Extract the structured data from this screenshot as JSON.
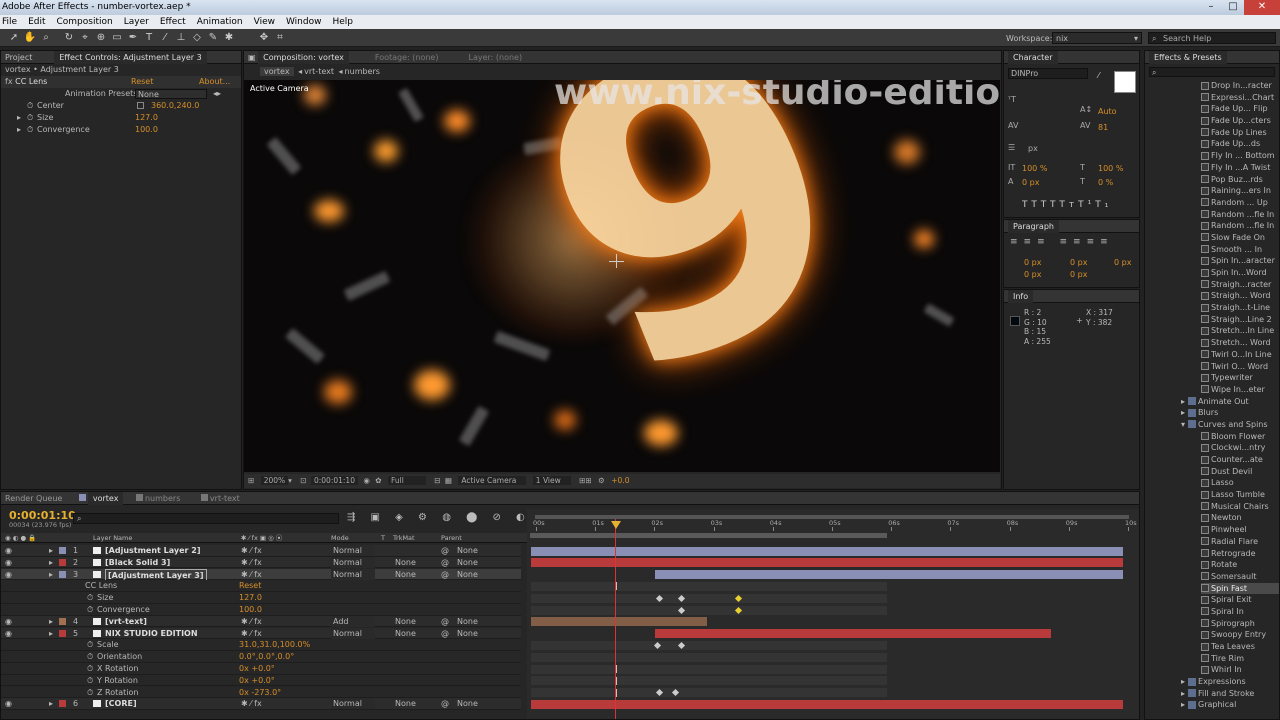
{
  "app": {
    "title": "Adobe After Effects - number-vortex.aep *"
  },
  "menu": [
    "File",
    "Edit",
    "Composition",
    "Layer",
    "Effect",
    "Animation",
    "View",
    "Window",
    "Help"
  ],
  "toolbar": {
    "workspace_label": "Workspace:",
    "workspace_value": "nix",
    "search_placeholder": "Search Help"
  },
  "effect_controls": {
    "project_tab": "Project",
    "tab": "Effect Controls: Adjustment Layer 3",
    "breadcrumb": "vortex • Adjustment Layer 3",
    "effect": "CC Lens",
    "reset": "Reset",
    "about": "About...",
    "presets_label": "Animation Presets:",
    "presets_value": "None",
    "props": [
      {
        "name": "Center",
        "value": "360.0,240.0"
      },
      {
        "name": "Size",
        "value": "127.0"
      },
      {
        "name": "Convergence",
        "value": "100.0"
      }
    ]
  },
  "composition": {
    "tab": "Composition: vortex",
    "footage_tab": "Footage: (none)",
    "layer_tab": "Layer: (none)",
    "crumbs": [
      "vortex",
      "vrt-text",
      "numbers"
    ],
    "active_camera": "Active Camera",
    "watermark": "www.nix-studio-edition.ru",
    "big_digit": "9",
    "zoom": "200%",
    "timecode": "0:00:01:10",
    "resolution": "Full",
    "camera": "Active Camera",
    "view": "1 View",
    "exposure": "+0.0"
  },
  "character": {
    "tab": "Character",
    "font": "DINPro",
    "size": "px",
    "auto": "Auto",
    "tracking": "81",
    "scale_v": "100 %",
    "scale_h": "100 %",
    "baseline": "0 px",
    "tsume": "0 %",
    "buttons": [
      "T",
      "T",
      "TT",
      "Tт",
      "T¹",
      "T₁"
    ]
  },
  "paragraph": {
    "tab": "Paragraph",
    "indents": [
      "0 px",
      "0 px",
      "0 px",
      "0 px",
      "0 px"
    ]
  },
  "info": {
    "tab": "Info",
    "r": "R : 2",
    "g": "G : 10",
    "b": "B : 15",
    "a": "A : 255",
    "x": "X : 317",
    "y": "Y : 382"
  },
  "effects_presets": {
    "tab": "Effects & Presets",
    "items": [
      "Drop In...racter",
      "Expressi...Chart",
      "Fade Up... Flip",
      "Fade Up...cters",
      "Fade Up Lines",
      "Fade Up...ds",
      "Fly In ... Bottom",
      "Fly In ...A Twist",
      "Pop Buz...rds",
      "Raining...ers In",
      "Random ... Up",
      "Random ...fle In",
      "Random ...fle In",
      "Slow Fade On",
      "Smooth ... In",
      "Spin In...aracter",
      "Spin In...Word",
      "Straigh...racter",
      "Straigh... Word",
      "Straigh...t-Line",
      "Straigh...Line 2",
      "Stretch...In Line",
      "Stretch... Word",
      "Twirl O...In Line",
      "Twirl O... Word",
      "Typewriter",
      "Wipe In...eter"
    ],
    "folders": [
      {
        "name": "Animate Out",
        "open": false
      },
      {
        "name": "Blurs",
        "open": false
      },
      {
        "name": "Curves and Spins",
        "open": true
      }
    ],
    "spins": [
      "Bloom Flower",
      "Clockwi...ntry",
      "Counter...ate",
      "Dust Devil",
      "Lasso",
      "Lasso Tumble",
      "Musical Chairs",
      "Newton",
      "Pinwheel",
      "Radial Flare",
      "Retrograde",
      "Rotate",
      "Somersault",
      "Spin Fast",
      "Spiral Exit",
      "Spiral In",
      "Spirograph",
      "Swoopy Entry",
      "Tea Leaves",
      "Tire Rim",
      "Whirl In"
    ],
    "folders2": [
      "Expressions",
      "Fill and Stroke",
      "Graphical"
    ],
    "selected": "Spin Fast"
  },
  "timeline": {
    "tabs": [
      "Render Queue",
      "vortex",
      "numbers",
      "vrt-text"
    ],
    "timecode": "0:00:01:10",
    "fps": "00034 (23.976 fps)",
    "search_placeholder": "",
    "cols": {
      "layer_name": "Layer Name",
      "mode": "Mode",
      "t": "T",
      "trkmat": "TrkMat",
      "parent": "Parent"
    },
    "ruler": [
      "00s",
      "01s",
      "02s",
      "03s",
      "04s",
      "05s",
      "06s",
      "07s",
      "08s",
      "09s",
      "10s"
    ],
    "rows": [
      {
        "num": "1",
        "name": "[Adjustment Layer 2]",
        "mode": "Normal",
        "trk": "",
        "parent": "None",
        "kind": "layer",
        "color": "#8a8fb5"
      },
      {
        "num": "2",
        "name": "[Black Solid 3]",
        "mode": "Normal",
        "trk": "None",
        "parent": "None",
        "kind": "layer",
        "color": "#b83a3a"
      },
      {
        "num": "3",
        "name": "[Adjustment Layer 3]",
        "mode": "Normal",
        "trk": "None",
        "parent": "None",
        "kind": "layer",
        "color": "#8a8fb5"
      },
      {
        "num": "",
        "name": "CC Lens",
        "value": "Reset",
        "kind": "effect"
      },
      {
        "num": "",
        "name": "Size",
        "value": "127.0",
        "kind": "prop"
      },
      {
        "num": "",
        "name": "Convergence",
        "value": "100.0",
        "kind": "prop"
      },
      {
        "num": "4",
        "name": "[vrt-text]",
        "mode": "Add",
        "trk": "None",
        "parent": "None",
        "kind": "layer",
        "color": "#a07050"
      },
      {
        "num": "5",
        "name": "NIX STUDIO EDITION",
        "mode": "Normal",
        "trk": "None",
        "parent": "None",
        "kind": "layer",
        "color": "#b83a3a"
      },
      {
        "num": "",
        "name": "Scale",
        "value": "31.0,31.0,100.0%",
        "kind": "prop"
      },
      {
        "num": "",
        "name": "Orientation",
        "value": "0.0°,0.0°,0.0°",
        "kind": "prop"
      },
      {
        "num": "",
        "name": "X Rotation",
        "value": "0x +0.0°",
        "kind": "prop"
      },
      {
        "num": "",
        "name": "Y Rotation",
        "value": "0x +0.0°",
        "kind": "prop"
      },
      {
        "num": "",
        "name": "Z Rotation",
        "value": "0x -273.0°",
        "kind": "prop"
      },
      {
        "num": "6",
        "name": "[CORE]",
        "mode": "Normal",
        "trk": "None",
        "parent": "None",
        "kind": "layer",
        "color": "#b83a3a"
      }
    ]
  }
}
